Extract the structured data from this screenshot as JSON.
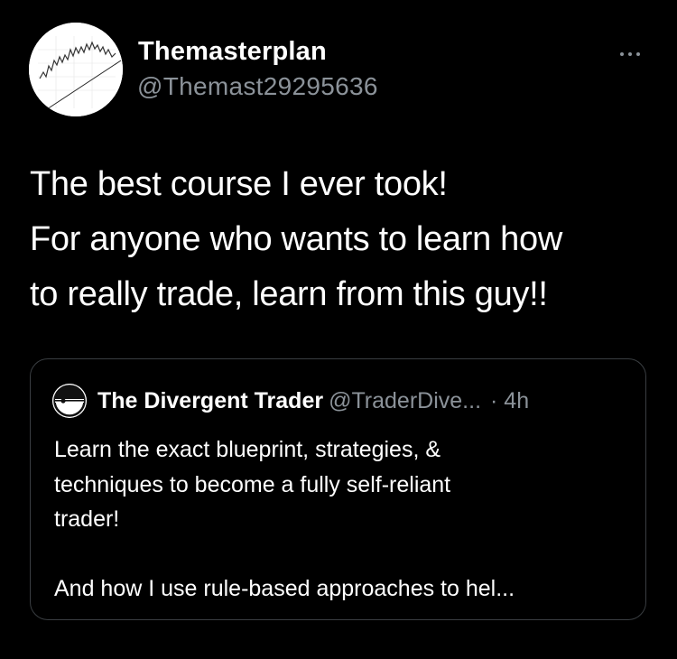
{
  "author": {
    "display_name": "Themasterplan",
    "handle": "@Themast29295636",
    "avatar_icon": "stock-chart-avatar-icon"
  },
  "menu": {
    "icon": "more-options-icon"
  },
  "tweet": {
    "lines": [
      "The best course I ever took!",
      "For anyone who wants to learn how",
      "to really trade, learn from this guy!!"
    ]
  },
  "quote": {
    "display_name": "The Divergent Trader",
    "handle": "@TraderDive...",
    "time": "· 4h",
    "avatar_icon": "divergent-logo-icon",
    "body_lines": [
      "Learn the exact blueprint, strategies, &",
      "techniques to become a fully self-reliant",
      "trader!"
    ],
    "body_line_after_gap": "And how I use rule-based approaches to hel..."
  },
  "colors": {
    "background": "#000000",
    "text_primary": "#ffffff",
    "text_secondary": "#8b9299",
    "border": "#3a3e42"
  }
}
